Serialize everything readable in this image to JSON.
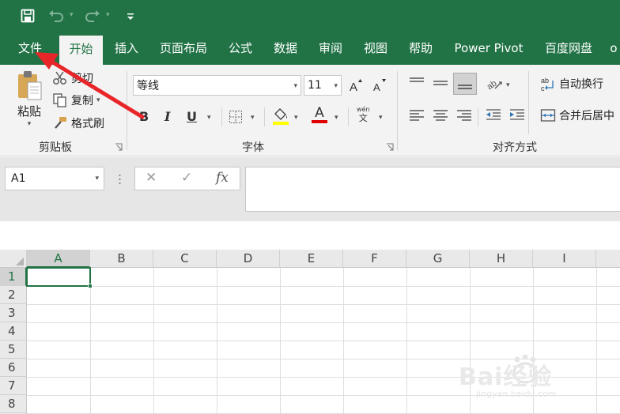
{
  "colors": {
    "brand": "#217346",
    "ribbon_bg": "#f3f3f3",
    "arrow": "#e8262a"
  },
  "quick_access": {
    "icons": [
      "save-icon",
      "undo-icon",
      "redo-icon",
      "customize-icon"
    ]
  },
  "tabs": [
    {
      "label": "文件"
    },
    {
      "label": "开始"
    },
    {
      "label": "插入"
    },
    {
      "label": "页面布局"
    },
    {
      "label": "公式"
    },
    {
      "label": "数据"
    },
    {
      "label": "审阅"
    },
    {
      "label": "视图"
    },
    {
      "label": "帮助"
    },
    {
      "label": "Power Pivot"
    },
    {
      "label": "百度网盘"
    },
    {
      "label": "o"
    }
  ],
  "active_tab": "开始",
  "clipboard": {
    "paste_label": "粘贴",
    "cut_label": "剪切",
    "copy_label": "复制",
    "format_painter_label": "格式刷",
    "group_label": "剪贴板"
  },
  "font": {
    "font_name": "等线",
    "font_size": "11",
    "bold_label": "B",
    "italic_label": "I",
    "underline_label": "U",
    "font_color_label": "A",
    "phonetic_label": "wén",
    "phonetic_char": "文",
    "group_label": "字体"
  },
  "alignment": {
    "wrap_text_label": "自动换行",
    "merge_center_label": "合并后居中",
    "group_label": "对齐方式"
  },
  "formula_bar": {
    "name_box_value": "A1",
    "cancel_symbol": "✕",
    "enter_symbol": "✓",
    "fx_label": "fx",
    "formula_value": ""
  },
  "sheet": {
    "columns": [
      "A",
      "B",
      "C",
      "D",
      "E",
      "F",
      "G",
      "H",
      "I"
    ],
    "rows": [
      "1",
      "2",
      "3",
      "4",
      "5",
      "6",
      "7",
      "8"
    ],
    "selected_cell": "A1"
  },
  "watermark": {
    "text": "Bai经验",
    "subtext": "jingyan.baidu.com"
  }
}
